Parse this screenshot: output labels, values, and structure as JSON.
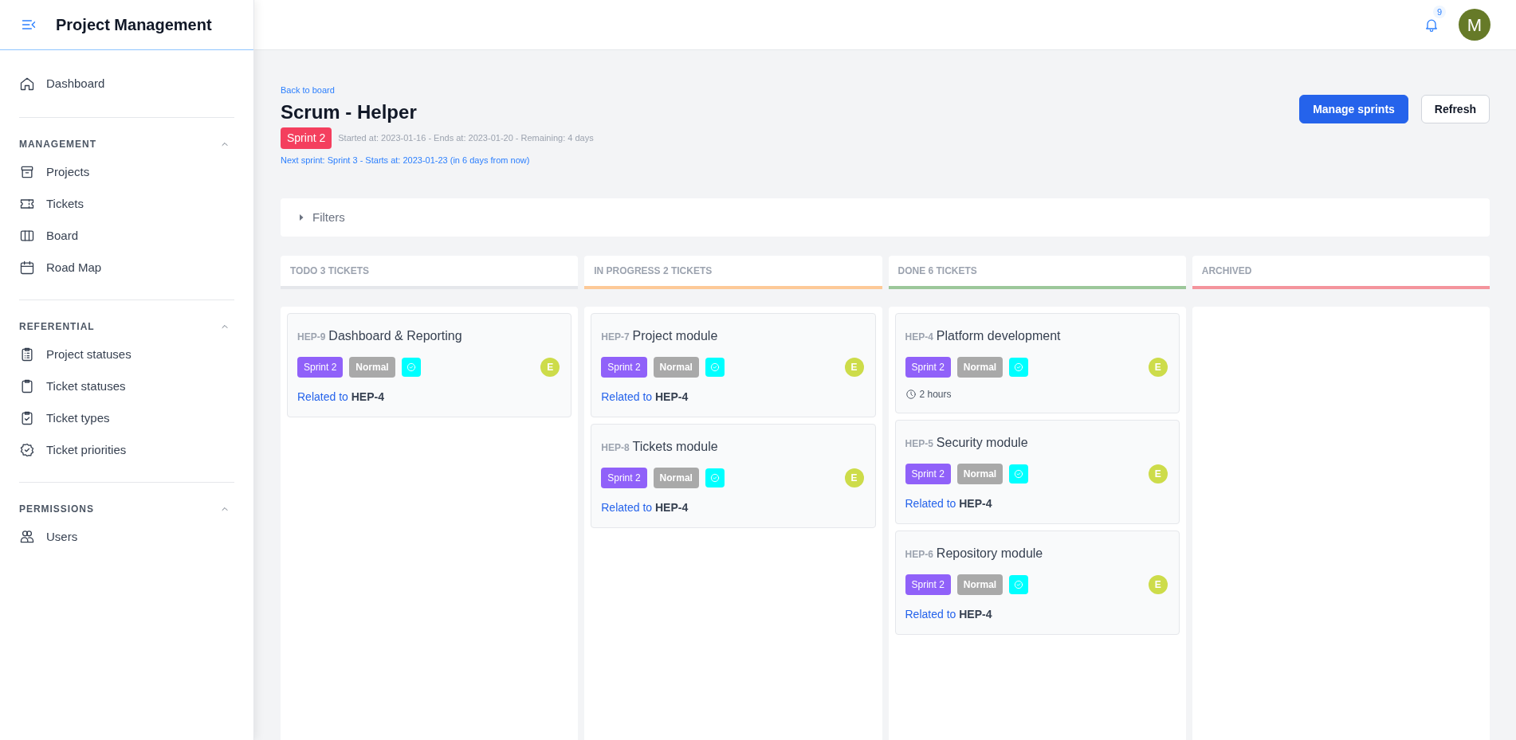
{
  "app": {
    "title": "Project Management"
  },
  "sidebar": {
    "items": [
      {
        "label": "Dashboard",
        "selected": false
      }
    ],
    "groups": [
      {
        "title": "MANAGEMENT",
        "expanded": true,
        "items": [
          {
            "label": "Projects",
            "selected": false
          },
          {
            "label": "Tickets",
            "selected": false
          },
          {
            "label": "Board",
            "selected": false
          },
          {
            "label": "Road Map",
            "selected": false
          }
        ]
      },
      {
        "title": "REFERENTIAL",
        "expanded": true,
        "items": [
          {
            "label": "Project statuses",
            "selected": false
          },
          {
            "label": "Ticket statuses",
            "selected": false
          },
          {
            "label": "Ticket types",
            "selected": false
          },
          {
            "label": "Ticket priorities",
            "selected": false
          }
        ]
      },
      {
        "title": "PERMISSIONS",
        "expanded": true,
        "items": [
          {
            "label": "Users",
            "selected": false
          }
        ]
      }
    ]
  },
  "topbar": {
    "notification_count": "9",
    "avatar": "M"
  },
  "page": {
    "back_link": "Back to board",
    "title": "Scrum - Helper",
    "sprint": "Sprint 2",
    "sprint_info": "Started at: 2023-01-16 - Ends at: 2023-01-20 - Remaining: 4 days",
    "next_sprint": "Next sprint: Sprint 3 - Starts at: 2023-01-23 (in 6 days from now)",
    "buttons": [
      {
        "label": "Manage sprints",
        "kind": "primary"
      },
      {
        "label": "Refresh",
        "kind": "secondary"
      }
    ]
  },
  "filters": {
    "label": "Filters",
    "expanded": false
  },
  "columns": [
    {
      "title": "TODO 3 TICKETS",
      "color": "#e5e7eb",
      "cards": [
        {
          "code": "HEP-9",
          "title": "Dashboard & Reporting",
          "sprint": "Sprint 2",
          "priority": "Normal",
          "assignee": "E",
          "footer": {
            "kind": "related",
            "label": "Related to",
            "ticket": "HEP-4"
          }
        }
      ]
    },
    {
      "title": "IN PROGRESS 2 TICKETS",
      "color": "#fdc997",
      "cards": [
        {
          "code": "HEP-7",
          "title": "Project module",
          "sprint": "Sprint 2",
          "priority": "Normal",
          "assignee": "E",
          "footer": {
            "kind": "related",
            "label": "Related to",
            "ticket": "HEP-4"
          }
        },
        {
          "code": "HEP-8",
          "title": "Tickets module",
          "sprint": "Sprint 2",
          "priority": "Normal",
          "assignee": "E",
          "footer": {
            "kind": "related",
            "label": "Related to",
            "ticket": "HEP-4"
          }
        }
      ]
    },
    {
      "title": "DONE 6 TICKETS",
      "color": "#9cc79a",
      "cards": [
        {
          "code": "HEP-4",
          "title": "Platform development",
          "sprint": "Sprint 2",
          "priority": "Normal",
          "assignee": "E",
          "footer": {
            "kind": "estimate",
            "label": "2 hours"
          }
        },
        {
          "code": "HEP-5",
          "title": "Security module",
          "sprint": "Sprint 2",
          "priority": "Normal",
          "assignee": "E",
          "footer": {
            "kind": "related",
            "label": "Related to",
            "ticket": "HEP-4"
          }
        },
        {
          "code": "HEP-6",
          "title": "Repository module",
          "sprint": "Sprint 2",
          "priority": "Normal",
          "assignee": "E",
          "footer": {
            "kind": "related",
            "label": "Related to",
            "ticket": "HEP-4"
          }
        }
      ]
    },
    {
      "title": "ARCHIVED",
      "color": "#f4949c"
    }
  ]
}
